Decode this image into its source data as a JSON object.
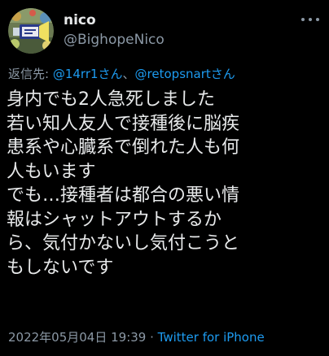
{
  "colors": {
    "background": "#000000",
    "primary_text": "#e7e9ea",
    "secondary_text": "#8b98a5",
    "link": "#1d9bf0"
  },
  "author": {
    "display_name": "nico",
    "handle": "@BighopeNico",
    "avatar_icon": "avatar-image"
  },
  "more_icon": "more-horizontal-icon",
  "reply": {
    "prefix": "返信先: ",
    "mention1": "@14rr1さん",
    "separator": "、",
    "mention2": "@retopsnartさん"
  },
  "tweet": {
    "lines": [
      "身内でも2人急死しました",
      "若い知人友人で接種後に脳疾",
      "患系や心臓系で倒れた人も何",
      "人もいます",
      "でも…接種者は都合の悪い情",
      "報はシャットアウトするか",
      "ら、気付かないし気付こうと",
      "もしないです"
    ]
  },
  "meta": {
    "timestamp": "2022年05月04日 19:39",
    "separator": " · ",
    "source": "Twitter for iPhone"
  }
}
